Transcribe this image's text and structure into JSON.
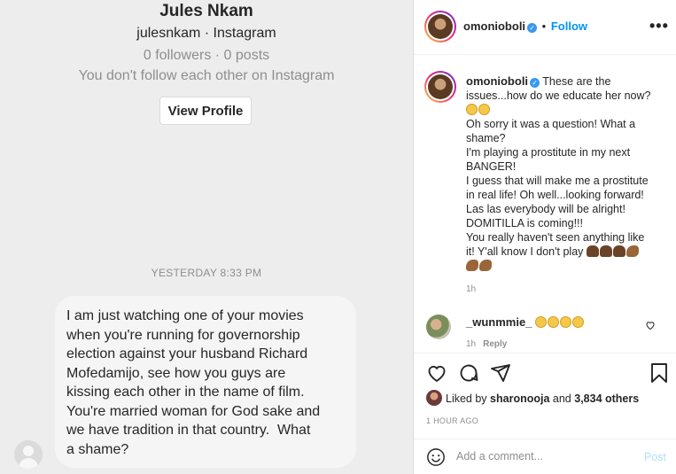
{
  "dm": {
    "profile_name": "Jules Nkam",
    "handle_line": "julesnkam · Instagram",
    "stats_line": "0 followers · 0 posts",
    "follow_note": "You don't follow each other on Instagram",
    "view_profile_label": "View Profile",
    "timestamp": "YESTERDAY 8:33 PM",
    "message_lines": [
      "I am just watching one of your movies",
      "when you're running for governorship",
      "election against your husband Richard",
      "Mofedamijo, see how you guys are",
      "kissing each other in the name of film.",
      "You're married woman for God sake and",
      "we have tradition in that country.  What",
      "a shame?"
    ]
  },
  "post": {
    "username": "omonioboli",
    "follow_label": "Follow",
    "separator": "•",
    "more_label": "•••",
    "caption_first": "These are the",
    "caption_lines": [
      "issues...how do we educate her now?",
      "Oh sorry it was a question! What a",
      "shame?",
      "I'm playing a prostitute in my next",
      "BANGER!",
      "I guess that will make me a prostitute",
      "in real life! Oh well...looking forward!",
      "Las las everybody will be alright!",
      "DOMITILLA is coming!!!",
      "You really haven't seen anything like",
      "it! Y'all know I don't play"
    ],
    "caption_time": "1h",
    "comment": {
      "username": "_wunmmie_",
      "time": "1h",
      "reply_label": "Reply"
    },
    "liked_prefix": "Liked by",
    "liked_user": "sharonooja",
    "liked_and": "and",
    "liked_count": "3,834 others",
    "ago": "1 HOUR AGO",
    "comment_placeholder": "Add a comment...",
    "post_label": "Post"
  }
}
